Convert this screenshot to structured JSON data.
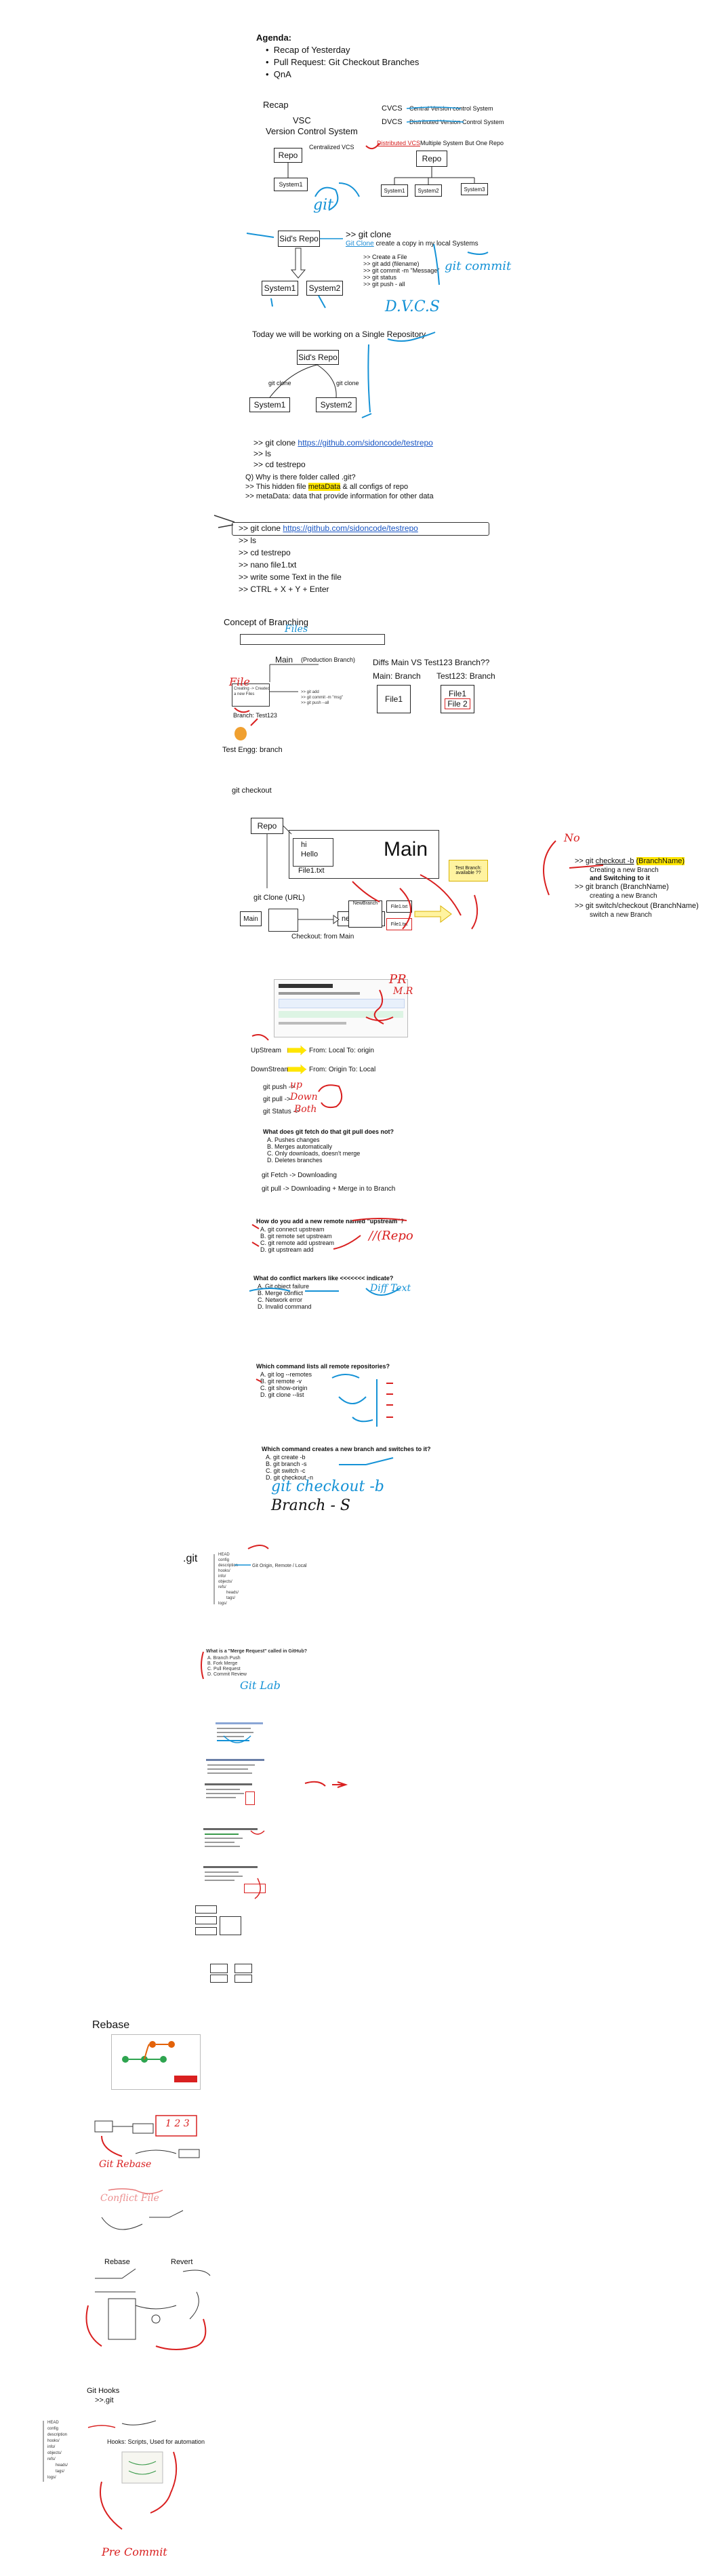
{
  "agenda": {
    "title": "Agenda:",
    "items": [
      "Recap of Yesterday",
      "Pull Request: Git Checkout Branches",
      "QnA"
    ]
  },
  "recap": {
    "title": "Recap",
    "vsc_label": "VSC",
    "vsc_full": "Version Control System",
    "cvcs": "CVCS",
    "cvcs_full": "Central Version control System",
    "dvcs": "DVCS",
    "dvcs_full": "Distributed Version Control System",
    "centralized_vcs": "Centralized VCS",
    "distributed_vcs": "Distributed VCS",
    "distributed_note": "Multiple System But One Repo",
    "repo": "Repo",
    "system1": "System1",
    "system2": "System2",
    "system3": "System3"
  },
  "clone_section": {
    "repo_box": "Sid's Repo",
    "git_clone": ">> git clone",
    "git_clone_desc_prefix": "Git Clone",
    "git_clone_desc": "create a copy in my local Systems",
    "steps": [
      ">> Create a File",
      ">> git add (filename)",
      ">> git commit -m \"Message\"",
      ">> git status",
      ">> git push - all"
    ],
    "system1": "System1",
    "system2": "System2",
    "hand_git_commit": "git commit"
  },
  "single_repo": {
    "heading": "Today we will be working on a Single Repository",
    "repo_box": "Sid's Repo",
    "git_clone_left": "git clone",
    "git_clone_right": "git clone",
    "system1": "System1",
    "system2": "System2",
    "hand_dvcs": "D.V.C.S"
  },
  "commands1": {
    "clone_prefix": ">> git clone ",
    "clone_url": "https://github.com/sidoncode/testrepo",
    "ls": ">> ls",
    "cd": ">> cd testrepo",
    "q": "Q) Why is there folder called .git?",
    "hidden_prefix": ">> This hidden file ",
    "hidden_hl": "metaData",
    "hidden_suffix": " & all configs of repo",
    "meta": ">> metaData: data that provide information for other data"
  },
  "commands2": {
    "clone_prefix": ">> git clone ",
    "clone_url": "https://github.com/sidoncode/testrepo",
    "ls": ">> ls",
    "cd": ">> cd testrepo",
    "nano": ">> nano file1.txt",
    "write": ">> write some Text in the file",
    "ctrl": ">> CTRL + X + Y + Enter"
  },
  "branching": {
    "heading": "Concept of Branching",
    "main": "Main",
    "production_branch": "(Production Branch)",
    "diffs": "Diffs Main VS Test123 Branch??",
    "main_branch": "Main: Branch",
    "test_branch": "Test123: Branch",
    "file1": "File1",
    "file2": "File 2",
    "branch_test": "Branch: Test123",
    "test_engg": "Test Engg: branch",
    "hand_file": "File",
    "hand_files": "Files"
  },
  "checkout_section": {
    "heading": "git checkout",
    "repo": "Repo",
    "hi": "hi",
    "hello": "Hello",
    "file1": "File1.txt",
    "main_big": "Main",
    "git_clone_url": "git Clone (URL)",
    "main_small": "Main",
    "new_branch": "new Branch",
    "checkout_from_main": "Checkout: from Main",
    "new_branch_box": "NewBranch",
    "file_boxes": [
      "File1.txt",
      "File1.txt"
    ],
    "sticky": "Test Branch: available ??",
    "cmds": [
      ">> git checkout -b (BranchName)",
      "Creating a new Branch",
      "and Switching to it",
      ">> git branch (BranchName)",
      "creating a new Branch",
      ">> git switch/checkout (BranchName)",
      "switch a new Branch"
    ],
    "hand_no": "No"
  },
  "streams": {
    "upstream": "UpStream",
    "upstream_desc": "From: Local To: origin",
    "downstream": "DownStream",
    "downstream_desc": "From: Origin To: Local",
    "push": "git push ->",
    "pull": "git pull ->",
    "status": "git Status ->",
    "hand_up": "up",
    "hand_down": "Down",
    "hand_both": "Both",
    "hand_pr": "PR",
    "hand_merge": "M.R"
  },
  "quiz1": {
    "question": "What does git fetch do that git pull does not?",
    "options": [
      "A. Pushes changes",
      "B. Merges automatically",
      "C. Only downloads, doesn't merge",
      "D. Deletes branches"
    ],
    "fetch": "git Fetch -> Downloading",
    "pull": "git pull -> Downloading + Merge in to Branch"
  },
  "quiz2": {
    "question": "How do you add a new remote named \"upstream\"?",
    "options": [
      "A. git connect upstream",
      "B. git remote set upstream",
      "C. git remote add upstream",
      "D. git upstream add"
    ],
    "hand": "Repo"
  },
  "quiz3": {
    "question": "What do conflict markers like <<<<<<< indicate?",
    "options": [
      "A. Git object failure",
      "B. Merge conflict",
      "C. Network error",
      "D. Invalid command"
    ],
    "hand": "Diff Text"
  },
  "quiz4": {
    "question": "Which command lists all remote repositories?",
    "options": [
      "A. git log --remotes",
      "B. git remote -v",
      "C. git show-origin",
      "D. git clone --list"
    ]
  },
  "quiz5": {
    "question": "Which command creates a new branch and switches to it?",
    "options": [
      "A. git create -b",
      "B. git branch -s",
      "C. git switch -c",
      "D. git checkout -n"
    ],
    "hand1": "git checkout -b",
    "hand2": "Branch - S"
  },
  "dotgit": {
    "title": ".git",
    "tree": [
      "HEAD",
      "config",
      "description",
      "hooks/",
      "info/",
      "objects/",
      "refs/",
      "heads/",
      "tags/",
      "logs/"
    ],
    "note": "Git Origin, Remote / Local"
  },
  "pr_quiz": {
    "question": "What is a \"Merge Request\" called in GitHub?",
    "options": [
      "A. Branch Push",
      "B. Fork Merge",
      "C. Pull Request",
      "D. Commit Review"
    ],
    "hand": "Git Lab"
  },
  "rebase": {
    "title": "Rebase",
    "revert": "Revert",
    "rebase_small": "Rebase",
    "hand_1": "1 2 3",
    "hand_2": "Git Rebase",
    "hand_3": "Conflict File"
  },
  "hooks": {
    "title": "Git Hooks",
    "path": ">>.git",
    "desc": "Hooks: Scripts, Used for automation",
    "tree": [
      "HEAD",
      "config",
      "description",
      "hooks/",
      "info/",
      "objects/",
      "refs/",
      "heads/",
      "tags/",
      "logs/"
    ],
    "hand": "Pre Commit"
  }
}
